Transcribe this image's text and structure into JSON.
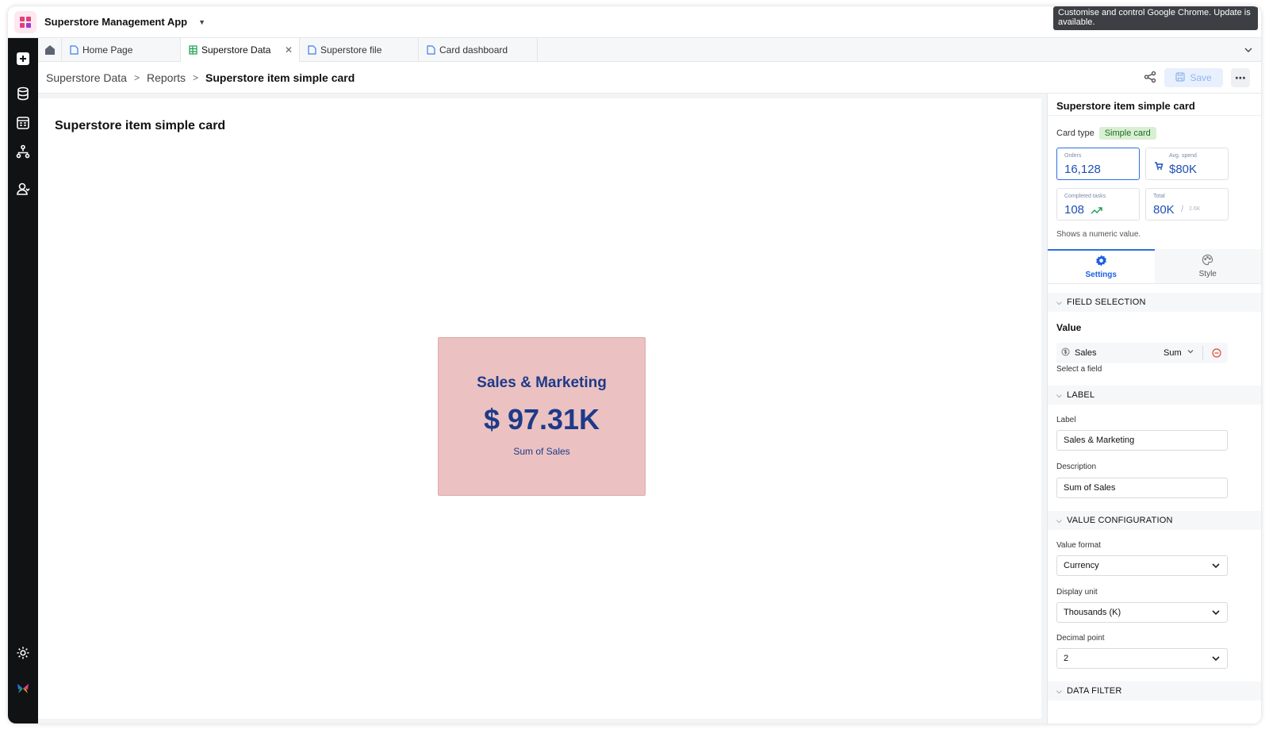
{
  "app": {
    "title": "Superstore Management App"
  },
  "notice": {
    "text": "Customise and control Google Chrome. Update is available."
  },
  "tabs": [
    {
      "label": "Home Page"
    },
    {
      "label": "Superstore Data"
    },
    {
      "label": "Superstore file"
    },
    {
      "label": "Card dashboard"
    }
  ],
  "breadcrumb": {
    "items": [
      "Superstore Data",
      "Reports"
    ],
    "current": "Superstore item simple card"
  },
  "toolbar": {
    "save_label": "Save"
  },
  "report": {
    "title": "Superstore item simple card"
  },
  "card": {
    "label": "Sales & Marketing",
    "value": "$ 97.31K",
    "description": "Sum of Sales",
    "bg_color": "#ebc2c1",
    "text_color": "#1e3a8a"
  },
  "panel": {
    "title": "Superstore item simple card",
    "card_type_label": "Card type",
    "card_type_value": "Simple card",
    "previews": [
      {
        "caption": "Orders",
        "value": "16,128"
      },
      {
        "caption": "Avg. spend",
        "value": "$80K"
      },
      {
        "caption": "Completed tasks",
        "value": "108"
      },
      {
        "caption": "Total",
        "value": "80K",
        "sub": "/",
        "subvalue": "2.6K"
      }
    ],
    "hint": "Shows a numeric value.",
    "tabs": {
      "settings": "Settings",
      "style": "Style"
    },
    "sections": {
      "field_selection": "FIELD SELECTION",
      "label": "LABEL",
      "value_configuration": "VALUE CONFIGURATION",
      "data_filter": "DATA FILTER"
    },
    "value_heading": "Value",
    "value_field": {
      "name": "Sales",
      "aggregate": "Sum"
    },
    "select_field_hint": "Select a field",
    "label_field": {
      "label": "Label",
      "value": "Sales & Marketing"
    },
    "description_field": {
      "label": "Description",
      "value": "Sum of Sales"
    },
    "value_format": {
      "label": "Value format",
      "value": "Currency"
    },
    "display_unit": {
      "label": "Display unit",
      "value": "Thousands (K)"
    },
    "decimal_point": {
      "label": "Decimal point",
      "value": "2"
    }
  },
  "colors": {
    "accent": "#2f6fe0",
    "sidebar": "#111214"
  }
}
